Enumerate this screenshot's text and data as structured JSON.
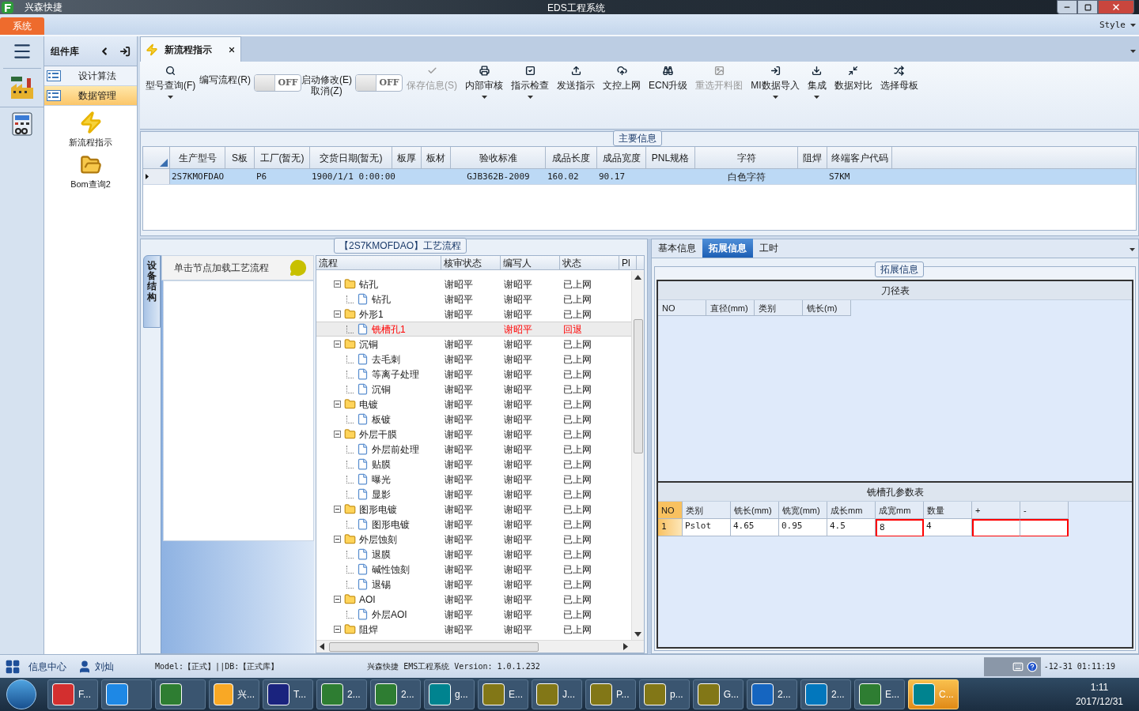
{
  "window": {
    "app_name": "兴森快捷",
    "title": "EDS工程系统"
  },
  "ribbon": {
    "tabs": [
      {
        "label": "系统",
        "selected": true
      }
    ],
    "style_label": "Style"
  },
  "sidebar": {
    "header": "组件库",
    "items": [
      {
        "label": "设计算法",
        "selected": false
      },
      {
        "label": "数据管理",
        "selected": true
      }
    ],
    "tools": [
      {
        "label": "新流程指示"
      },
      {
        "label": "Bom查询2"
      }
    ]
  },
  "document_tab": {
    "label": "新流程指示",
    "selected": true
  },
  "toolbar": [
    {
      "kind": "button",
      "label": "型号查询(F)",
      "disabled": false,
      "dropdown": true
    },
    {
      "kind": "toggle",
      "label": "编写流程(R)",
      "on": false,
      "state_text": "OFF"
    },
    {
      "kind": "toggle",
      "label": "启动修改(E)\n取消(Z)",
      "on": false,
      "state_text": "OFF"
    },
    {
      "kind": "button",
      "label": "保存信息(S)",
      "disabled": true,
      "dropdown": false
    },
    {
      "kind": "button",
      "label": "内部审核",
      "disabled": false,
      "dropdown": true
    },
    {
      "kind": "button",
      "label": "指示检查",
      "disabled": false,
      "dropdown": true
    },
    {
      "kind": "button",
      "label": "发送指示",
      "disabled": false,
      "dropdown": false
    },
    {
      "kind": "button",
      "label": "文控上网",
      "disabled": false,
      "dropdown": false
    },
    {
      "kind": "button",
      "label": "ECN升级",
      "disabled": false,
      "dropdown": false
    },
    {
      "kind": "button",
      "label": "重选开料图",
      "disabled": true,
      "dropdown": false
    },
    {
      "kind": "button",
      "label": "MI数据导入",
      "disabled": false,
      "dropdown": true
    },
    {
      "kind": "button",
      "label": "集成",
      "disabled": false,
      "dropdown": true
    },
    {
      "kind": "button",
      "label": "数据对比",
      "disabled": false,
      "dropdown": false
    },
    {
      "kind": "button",
      "label": "选择母板",
      "disabled": false,
      "dropdown": false
    }
  ],
  "main_info": {
    "title": "主要信息",
    "columns": [
      "生产型号",
      "S板",
      "工厂(暂无)",
      "交货日期(暂无)",
      "板厚",
      "板材",
      "验收标准",
      "成品长度",
      "成品宽度",
      "PNL规格",
      "字符",
      "阻焊",
      "终端客户代码"
    ],
    "rows": [
      {
        "selected": true,
        "cells": [
          "2S7KMOFDAO",
          "",
          "P6",
          "1900/1/1 0:00:00",
          "",
          "",
          "GJB362B-2009",
          "160.02",
          "90.17",
          "",
          "白色字符",
          "",
          "S7KM"
        ]
      }
    ]
  },
  "process": {
    "title": "【2S7KMOFDAO】工艺流程",
    "side_tab": "设备结构",
    "hint": "单击节点加载工艺流程",
    "columns": [
      "流程",
      "核审状态",
      "编写人",
      "状态",
      "Pl"
    ],
    "tree": [
      {
        "name": "钻孔",
        "review": "谢昭平",
        "writer": "谢昭平",
        "status": "已上网",
        "expanded": true,
        "selected": false,
        "rejected": false,
        "children": [
          {
            "name": "钻孔",
            "review": "谢昭平",
            "writer": "谢昭平",
            "status": "已上网",
            "selected": false,
            "rejected": false
          }
        ]
      },
      {
        "name": "外形1",
        "review": "谢昭平",
        "writer": "谢昭平",
        "status": "已上网",
        "expanded": true,
        "selected": false,
        "rejected": false,
        "children": [
          {
            "name": "铣槽孔1",
            "writer": "谢昭平",
            "status": "回退",
            "selected": true,
            "rejected": true
          }
        ]
      },
      {
        "name": "沉铜",
        "review": "谢昭平",
        "writer": "谢昭平",
        "status": "已上网",
        "expanded": true,
        "selected": false,
        "rejected": false,
        "children": [
          {
            "name": "去毛刺",
            "review": "谢昭平",
            "writer": "谢昭平",
            "status": "已上网",
            "selected": false,
            "rejected": false
          },
          {
            "name": "等离子处理",
            "review": "谢昭平",
            "writer": "谢昭平",
            "status": "已上网",
            "selected": false,
            "rejected": false
          },
          {
            "name": "沉铜",
            "review": "谢昭平",
            "writer": "谢昭平",
            "status": "已上网",
            "selected": false,
            "rejected": false
          }
        ]
      },
      {
        "name": "电镀",
        "review": "谢昭平",
        "writer": "谢昭平",
        "status": "已上网",
        "expanded": true,
        "selected": false,
        "rejected": false,
        "children": [
          {
            "name": "板镀",
            "review": "谢昭平",
            "writer": "谢昭平",
            "status": "已上网",
            "selected": false,
            "rejected": false
          }
        ]
      },
      {
        "name": "外层干膜",
        "review": "谢昭平",
        "writer": "谢昭平",
        "status": "已上网",
        "expanded": true,
        "selected": false,
        "rejected": false,
        "children": [
          {
            "name": "外层前处理",
            "review": "谢昭平",
            "writer": "谢昭平",
            "status": "已上网",
            "selected": false,
            "rejected": false
          },
          {
            "name": "贴膜",
            "review": "谢昭平",
            "writer": "谢昭平",
            "status": "已上网",
            "selected": false,
            "rejected": false
          },
          {
            "name": "曝光",
            "review": "谢昭平",
            "writer": "谢昭平",
            "status": "已上网",
            "selected": false,
            "rejected": false
          },
          {
            "name": "显影",
            "review": "谢昭平",
            "writer": "谢昭平",
            "status": "已上网",
            "selected": false,
            "rejected": false
          }
        ]
      },
      {
        "name": "图形电镀",
        "review": "谢昭平",
        "writer": "谢昭平",
        "status": "已上网",
        "expanded": true,
        "selected": false,
        "rejected": false,
        "children": [
          {
            "name": "图形电镀",
            "review": "谢昭平",
            "writer": "谢昭平",
            "status": "已上网",
            "selected": false,
            "rejected": false
          }
        ]
      },
      {
        "name": "外层蚀刻",
        "review": "谢昭平",
        "writer": "谢昭平",
        "status": "已上网",
        "expanded": true,
        "selected": false,
        "rejected": false,
        "children": [
          {
            "name": "退膜",
            "review": "谢昭平",
            "writer": "谢昭平",
            "status": "已上网",
            "selected": false,
            "rejected": false
          },
          {
            "name": "碱性蚀刻",
            "review": "谢昭平",
            "writer": "谢昭平",
            "status": "已上网",
            "selected": false,
            "rejected": false
          },
          {
            "name": "退锡",
            "review": "谢昭平",
            "writer": "谢昭平",
            "status": "已上网",
            "selected": false,
            "rejected": false
          }
        ]
      },
      {
        "name": "AOI",
        "review": "谢昭平",
        "writer": "谢昭平",
        "status": "已上网",
        "expanded": true,
        "selected": false,
        "rejected": false,
        "children": [
          {
            "name": "外层AOI",
            "review": "谢昭平",
            "writer": "谢昭平",
            "status": "已上网",
            "selected": false,
            "rejected": false
          }
        ]
      },
      {
        "name": "阻焊",
        "review": "谢昭平",
        "writer": "谢昭平",
        "status": "已上网",
        "expanded": true,
        "selected": false,
        "rejected": false
      }
    ]
  },
  "detail": {
    "tabs": [
      {
        "label": "基本信息",
        "selected": false
      },
      {
        "label": "拓展信息",
        "selected": true
      },
      {
        "label": "工时",
        "selected": false
      }
    ],
    "group_title": "拓展信息",
    "cutter_table": {
      "title": "刀径表",
      "columns": [
        "NO",
        "直径(mm)",
        "类别",
        "铣长(m)"
      ]
    },
    "slot_table": {
      "title": "铣槽孔参数表",
      "columns": [
        "NO",
        "类别",
        "铣长(mm)",
        "铣宽(mm)",
        "成长mm",
        "成宽mm",
        "数量",
        "+",
        "-"
      ],
      "rows": [
        {
          "selected": true,
          "cells": [
            {
              "text": "1",
              "marked": false
            },
            {
              "text": "Pslot",
              "marked": false
            },
            {
              "text": "4.65",
              "marked": false
            },
            {
              "text": "0.95",
              "marked": false
            },
            {
              "text": "4.5",
              "marked": false
            },
            {
              "text": "8",
              "marked": true
            },
            {
              "text": "4",
              "marked": false
            },
            {
              "marked": true
            },
            {
              "marked": true
            }
          ]
        }
      ]
    }
  },
  "status_bar": {
    "info_center": "信息中心",
    "user": "刘灿",
    "model": "Model:【正式】||DB:【正式库】",
    "product": "兴森快捷 EMS工程系统 Version: 1.0.1.232",
    "time": "-12-31 01:11:19"
  },
  "taskbar": {
    "items": [
      {
        "label": "F...",
        "selected": false
      },
      {
        "selected": false
      },
      {
        "selected": false
      },
      {
        "label": "兴...",
        "selected": false
      },
      {
        "label": "T...",
        "selected": false
      },
      {
        "label": "2...",
        "selected": false
      },
      {
        "label": "2...",
        "selected": false
      },
      {
        "label": "g...",
        "selected": false
      },
      {
        "label": "E...",
        "selected": false
      },
      {
        "label": "J...",
        "selected": false
      },
      {
        "label": "P...",
        "selected": false
      },
      {
        "label": "p...",
        "selected": false
      },
      {
        "label": "G...",
        "selected": false
      },
      {
        "label": "2...",
        "selected": false
      },
      {
        "label": "2...",
        "selected": false
      },
      {
        "label": "E...",
        "selected": false
      },
      {
        "label": "C...",
        "selected": true
      }
    ],
    "clock_time": "1:11",
    "clock_date": "2017/12/31"
  }
}
